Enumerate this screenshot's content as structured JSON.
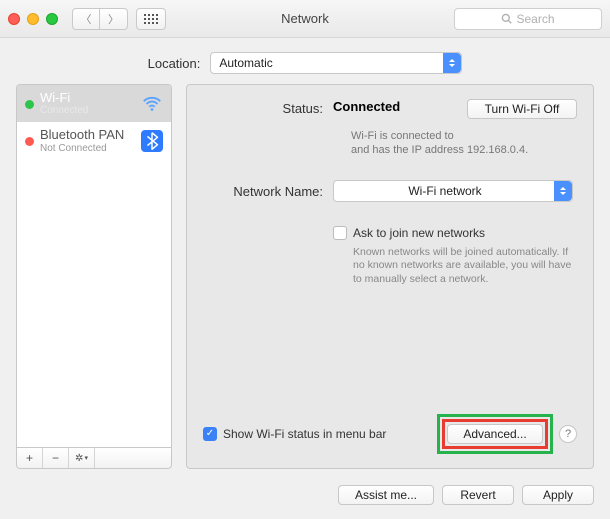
{
  "header": {
    "title": "Network",
    "search_placeholder": "Search"
  },
  "location": {
    "label": "Location:",
    "value": "Automatic"
  },
  "sidebar": {
    "services": [
      {
        "name": "Wi-Fi",
        "status": "Connected",
        "icon": "wifi",
        "dot": "green",
        "selected": true
      },
      {
        "name": "Bluetooth PAN",
        "status": "Not Connected",
        "icon": "bluetooth",
        "dot": "red",
        "selected": false
      }
    ]
  },
  "main": {
    "status_label": "Status:",
    "status_value": "Connected",
    "turn_off_label": "Turn Wi-Fi Off",
    "status_sub": "Wi-Fi is connected to\nand has the IP address 192.168.0.4.",
    "network_name_label": "Network Name:",
    "network_name_value": "Wi-Fi network",
    "ask_join_label": "Ask to join new networks",
    "ask_join_sub": "Known networks will be joined automatically. If no known networks are available, you will have to manually select a network.",
    "show_status_label": "Show Wi-Fi status in menu bar",
    "show_status_checked": true,
    "advanced_label": "Advanced...",
    "help_label": "?"
  },
  "buttons": {
    "assist": "Assist me...",
    "revert": "Revert",
    "apply": "Apply"
  }
}
